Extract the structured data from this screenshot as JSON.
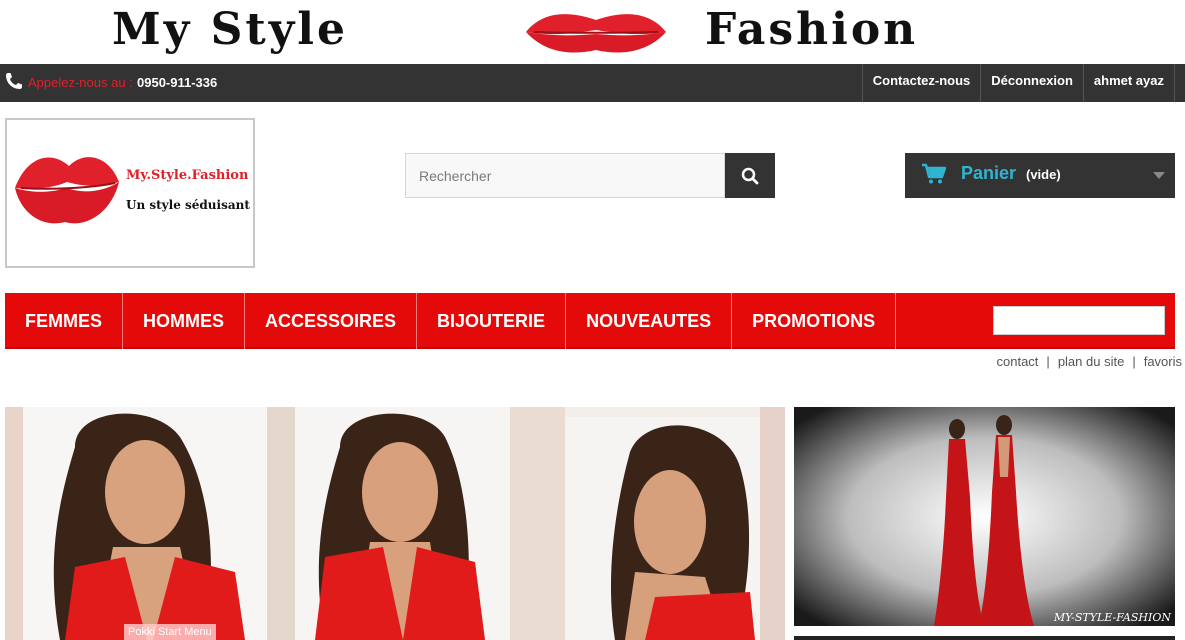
{
  "banner": {
    "title_left": "My Style",
    "title_right": "Fashion",
    "lips_icon": "lips-kiss-icon"
  },
  "topbar": {
    "phone_icon": "phone-icon",
    "call_label": "Appelez-nous au :",
    "phone_number": "0950-911-336",
    "links": [
      "Contactez-nous",
      "Déconnexion",
      "ahmet ayaz"
    ]
  },
  "logo": {
    "name": "My.Style.Fashion",
    "tagline": "Un style séduisant"
  },
  "search": {
    "placeholder": "Rechercher",
    "icon": "search-icon"
  },
  "cart": {
    "label": "Panier",
    "status": "(vide)",
    "icon": "cart-icon"
  },
  "nav": {
    "items": [
      "FEMMES",
      "HOMMES",
      "ACCESSOIRES",
      "BIJOUTERIE",
      "NOUVEAUTES",
      "PROMOTIONS"
    ]
  },
  "sublinks": [
    "contact",
    "plan du site",
    "favoris"
  ],
  "side_image": {
    "caption": "MY-STYLE-FASHION"
  },
  "taskbar": {
    "label": "Pokki Start Menu"
  },
  "colors": {
    "nav_red": "#e50a0a",
    "dark_bar": "#333333",
    "accent_blue": "#2fb5d2",
    "lips_red": "#e0202a"
  }
}
